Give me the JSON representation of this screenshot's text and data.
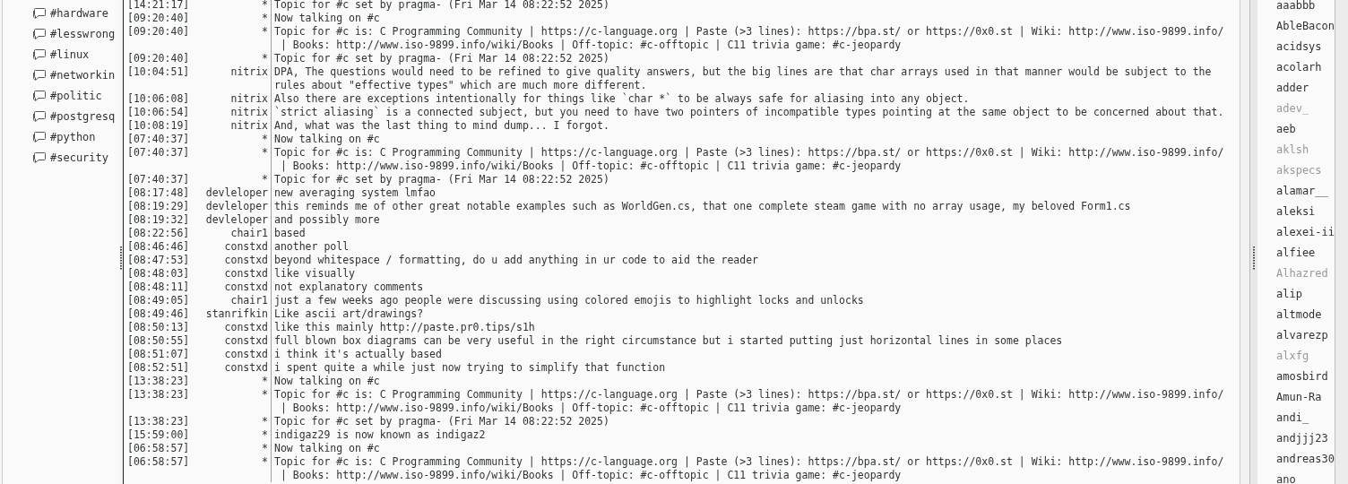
{
  "channels": [
    {
      "name": "#hardware"
    },
    {
      "name": "#lesswrong"
    },
    {
      "name": "#linux"
    },
    {
      "name": "#networkin"
    },
    {
      "name": "#politic"
    },
    {
      "name": "#postgresq"
    },
    {
      "name": "#python"
    },
    {
      "name": "#security"
    }
  ],
  "messages": [
    {
      "time": "[14:21:17]",
      "nick": "*",
      "text": "Topic for #c set by pragma- (Fri Mar 14 08:22:52 2025)"
    },
    {
      "time": "[09:20:40]",
      "nick": "*",
      "text": "Now talking on #c"
    },
    {
      "time": "[09:20:40]",
      "nick": "*",
      "text": "Topic for #c is: C Programming Community | https://c-language.org | Paste (>3 lines): https://bpa.st/ or https://0x0.st | Wiki: http://www.iso-9899.info/\n | Books: http://www.iso-9899.info/wiki/Books | Off-topic: #c-offtopic | C11 trivia game: #c-jeopardy"
    },
    {
      "time": "[09:20:40]",
      "nick": "*",
      "text": "Topic for #c set by pragma- (Fri Mar 14 08:22:52 2025)"
    },
    {
      "time": "[10:04:51]",
      "nick": "nitrix",
      "text": "DPA, The questions would need to be refined to give quality answers, but the big lines are that char arrays used in that manner would be subject to the\nrules about \"effective types\" which are much more different."
    },
    {
      "time": "[10:06:08]",
      "nick": "nitrix",
      "text": "Also there are exceptions intentionally for things like `char *` to be always safe for aliasing into any object."
    },
    {
      "time": "[10:06:54]",
      "nick": "nitrix",
      "text": "`strict aliasing` is a connected subject, but you need to have two pointers of incompatible types pointing at the same object to be concerned about that."
    },
    {
      "time": "[10:08:19]",
      "nick": "nitrix",
      "text": "And, what was the last thing to mind dump... I forgot."
    },
    {
      "time": "[07:40:37]",
      "nick": "*",
      "text": "Now talking on #c"
    },
    {
      "time": "[07:40:37]",
      "nick": "*",
      "text": "Topic for #c is: C Programming Community | https://c-language.org | Paste (>3 lines): https://bpa.st/ or https://0x0.st | Wiki: http://www.iso-9899.info/\n | Books: http://www.iso-9899.info/wiki/Books | Off-topic: #c-offtopic | C11 trivia game: #c-jeopardy"
    },
    {
      "time": "[07:40:37]",
      "nick": "*",
      "text": "Topic for #c set by pragma- (Fri Mar 14 08:22:52 2025)"
    },
    {
      "time": "[08:17:48]",
      "nick": "devleloper",
      "text": "new averaging system lmfao"
    },
    {
      "time": "[08:19:29]",
      "nick": "devleloper",
      "text": "this reminds me of other great notable examples such as WorldGen.cs, that one complete steam game with no array usage, my beloved Form1.cs"
    },
    {
      "time": "[08:19:32]",
      "nick": "devleloper",
      "text": "and possibly more"
    },
    {
      "time": "[08:22:56]",
      "nick": "chair1",
      "text": "based"
    },
    {
      "time": "[08:46:46]",
      "nick": "constxd",
      "text": "another poll"
    },
    {
      "time": "[08:47:53]",
      "nick": "constxd",
      "text": "beyond whitespace / formatting, do u add anything in ur code to aid the reader"
    },
    {
      "time": "[08:48:03]",
      "nick": "constxd",
      "text": "like visually"
    },
    {
      "time": "[08:48:11]",
      "nick": "constxd",
      "text": "not explanatory comments"
    },
    {
      "time": "[08:49:05]",
      "nick": "chair1",
      "text": "just a few weeks ago people were discussing using colored emojis to highlight locks and unlocks"
    },
    {
      "time": "[08:49:46]",
      "nick": "stanrifkin",
      "text": "Like ascii art/drawings?"
    },
    {
      "time": "[08:50:13]",
      "nick": "constxd",
      "text": "like this mainly http://paste.pr0.tips/s1h"
    },
    {
      "time": "[08:50:55]",
      "nick": "constxd",
      "text": "full blown box diagrams can be very useful in the right circumstance but i started putting just horizontal lines in some places"
    },
    {
      "time": "[08:51:07]",
      "nick": "constxd",
      "text": "i think it's actually based"
    },
    {
      "time": "[08:52:51]",
      "nick": "constxd",
      "text": "i spent quite a while just now trying to simplify that function"
    },
    {
      "time": "[13:38:23]",
      "nick": "*",
      "text": "Now talking on #c"
    },
    {
      "time": "[13:38:23]",
      "nick": "*",
      "text": "Topic for #c is: C Programming Community | https://c-language.org | Paste (>3 lines): https://bpa.st/ or https://0x0.st | Wiki: http://www.iso-9899.info/\n | Books: http://www.iso-9899.info/wiki/Books | Off-topic: #c-offtopic | C11 trivia game: #c-jeopardy"
    },
    {
      "time": "[13:38:23]",
      "nick": "*",
      "text": "Topic for #c set by pragma- (Fri Mar 14 08:22:52 2025)"
    },
    {
      "time": "[15:59:00]",
      "nick": "*",
      "text": "indigaz29 is now known as indigaz2"
    },
    {
      "time": "[06:58:57]",
      "nick": "*",
      "text": "Now talking on #c"
    },
    {
      "time": "[06:58:57]",
      "nick": "*",
      "text": "Topic for #c is: C Programming Community | https://c-language.org | Paste (>3 lines): https://bpa.st/ or https://0x0.st | Wiki: http://www.iso-9899.info/\n | Books: http://www.iso-9899.info/wiki/Books | Off-topic: #c-offtopic | C11 trivia game: #c-jeopardy"
    }
  ],
  "users": [
    {
      "nick": "aaabbb",
      "away": false
    },
    {
      "nick": "AbleBacon",
      "away": false
    },
    {
      "nick": "acidsys",
      "away": false
    },
    {
      "nick": "acolarh",
      "away": false
    },
    {
      "nick": "adder",
      "away": false
    },
    {
      "nick": "adev_",
      "away": true
    },
    {
      "nick": "aeb",
      "away": false
    },
    {
      "nick": "aklsh",
      "away": true
    },
    {
      "nick": "akspecs",
      "away": true
    },
    {
      "nick": "alamar__",
      "away": false
    },
    {
      "nick": "aleksi",
      "away": false
    },
    {
      "nick": "alexei-ii",
      "away": false
    },
    {
      "nick": "alfiee",
      "away": false
    },
    {
      "nick": "Alhazred",
      "away": true
    },
    {
      "nick": "alip",
      "away": false
    },
    {
      "nick": "altmode",
      "away": false
    },
    {
      "nick": "alvarezp",
      "away": false
    },
    {
      "nick": "alxfg",
      "away": true
    },
    {
      "nick": "amosbird",
      "away": false
    },
    {
      "nick": "Amun-Ra",
      "away": false
    },
    {
      "nick": "andi_",
      "away": false
    },
    {
      "nick": "andjjj23",
      "away": false
    },
    {
      "nick": "andreas30",
      "away": false
    },
    {
      "nick": "ano",
      "away": false
    }
  ]
}
